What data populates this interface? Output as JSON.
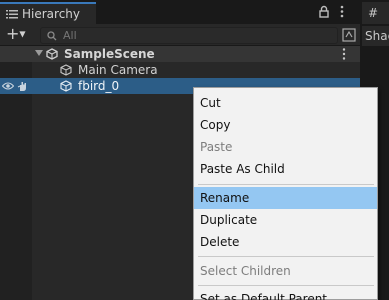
{
  "tab": {
    "title": "Hierarchy",
    "second_tab_glyph": "#",
    "second_panel_text": "Shac"
  },
  "toolbar": {
    "add_symbol": "+",
    "search_placeholder": "All"
  },
  "scene": {
    "name": "SampleScene"
  },
  "objects": [
    {
      "name": "Main Camera",
      "selected": false
    },
    {
      "name": "fbird_0",
      "selected": true
    }
  ],
  "context_menu": {
    "items": [
      {
        "label": "Cut",
        "disabled": false,
        "hover": false
      },
      {
        "label": "Copy",
        "disabled": false,
        "hover": false
      },
      {
        "label": "Paste",
        "disabled": true,
        "hover": false
      },
      {
        "label": "Paste As Child",
        "disabled": false,
        "hover": false
      },
      {
        "label": "Rename",
        "disabled": false,
        "hover": true
      },
      {
        "label": "Duplicate",
        "disabled": false,
        "hover": false
      },
      {
        "label": "Delete",
        "disabled": false,
        "hover": false
      },
      {
        "label": "Select Children",
        "disabled": true,
        "hover": false
      },
      {
        "label": "Set as Default Parent",
        "disabled": false,
        "hover": false
      }
    ]
  },
  "colors": {
    "selection": "#2c5d87",
    "menu_hover": "#94c7f2",
    "tab_accent": "#3a79bb"
  },
  "icons": [
    "hierarchy-list-icon",
    "lock-icon",
    "kebab-menu-icon",
    "search-icon",
    "scene-icon",
    "gameobject-icon",
    "visibility-eye-icon",
    "pickable-hand-icon"
  ]
}
